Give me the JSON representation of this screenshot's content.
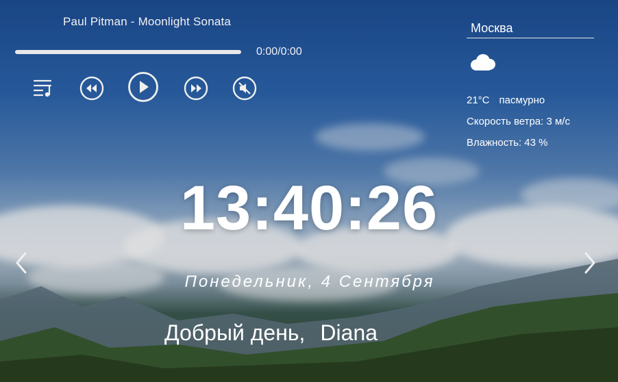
{
  "player": {
    "track_title": "Paul Pitman - Moonlight Sonata",
    "progress": 0,
    "time_display": "0:00/0:00",
    "controls": [
      "playlist-icon",
      "rewind-icon",
      "play-icon",
      "forward-icon",
      "mute-icon"
    ]
  },
  "weather": {
    "city": "Москва",
    "icon": "cloud-icon",
    "temperature": "21°C",
    "description": "пасмурно",
    "wind": "Скорость ветра: 3 м/с",
    "humidity": "Влажность: 43 %"
  },
  "clock": {
    "time": "13:40:26",
    "date": "Понедельник, 4 Сентября"
  },
  "greeting": {
    "text": "Добрый день,",
    "name": "Diana"
  },
  "nav": {
    "prev_icon": "chevron-left-icon",
    "next_icon": "chevron-right-icon"
  }
}
